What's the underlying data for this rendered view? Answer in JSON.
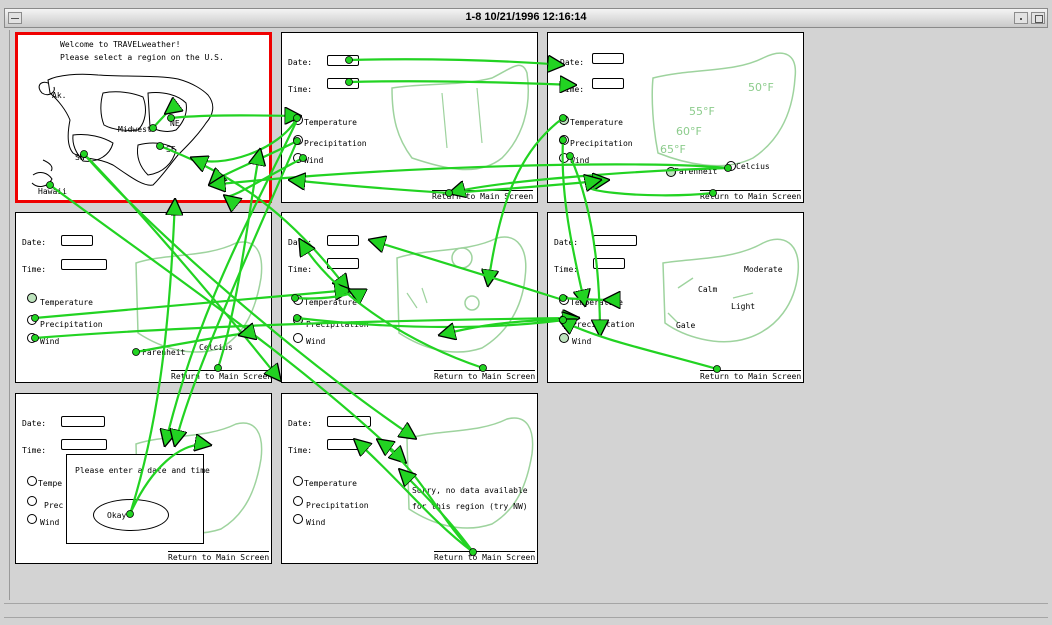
{
  "window": {
    "title": "1-8  10/21/1996 12:16:14"
  },
  "labels": {
    "date": "Date:",
    "time": "Time:",
    "temperature": "Temperature",
    "precipitation": "Precipitation",
    "wind": "Wind",
    "return": "Return to Main Screen",
    "celsius": "Celcius",
    "farenheit": "Farenheit"
  },
  "s1": {
    "welcome": "Welcome to TRAVELweather!",
    "prompt": "Please select a region on the U.S.",
    "regions": [
      "Ak.",
      "Midwest",
      "NE",
      "SE",
      "SW",
      "Hawaii"
    ]
  },
  "s3": {
    "temps": [
      "55°F",
      "50°F",
      "60°F",
      "65°F"
    ]
  },
  "s6": {
    "winds": [
      "Moderate",
      "Calm",
      "Light",
      "Gale"
    ]
  },
  "s7": {
    "popup": "Please enter a date and time",
    "okay": "Okay",
    "temp_short": "Tempe",
    "prec_short": "Prec"
  },
  "s8": {
    "msg1": "Sorry, no data available",
    "msg2": "for this region (try NW)"
  },
  "colors": {
    "link": "#22d322",
    "selected_border": "#ef0000",
    "sketch_faint": "#9ed39e"
  }
}
